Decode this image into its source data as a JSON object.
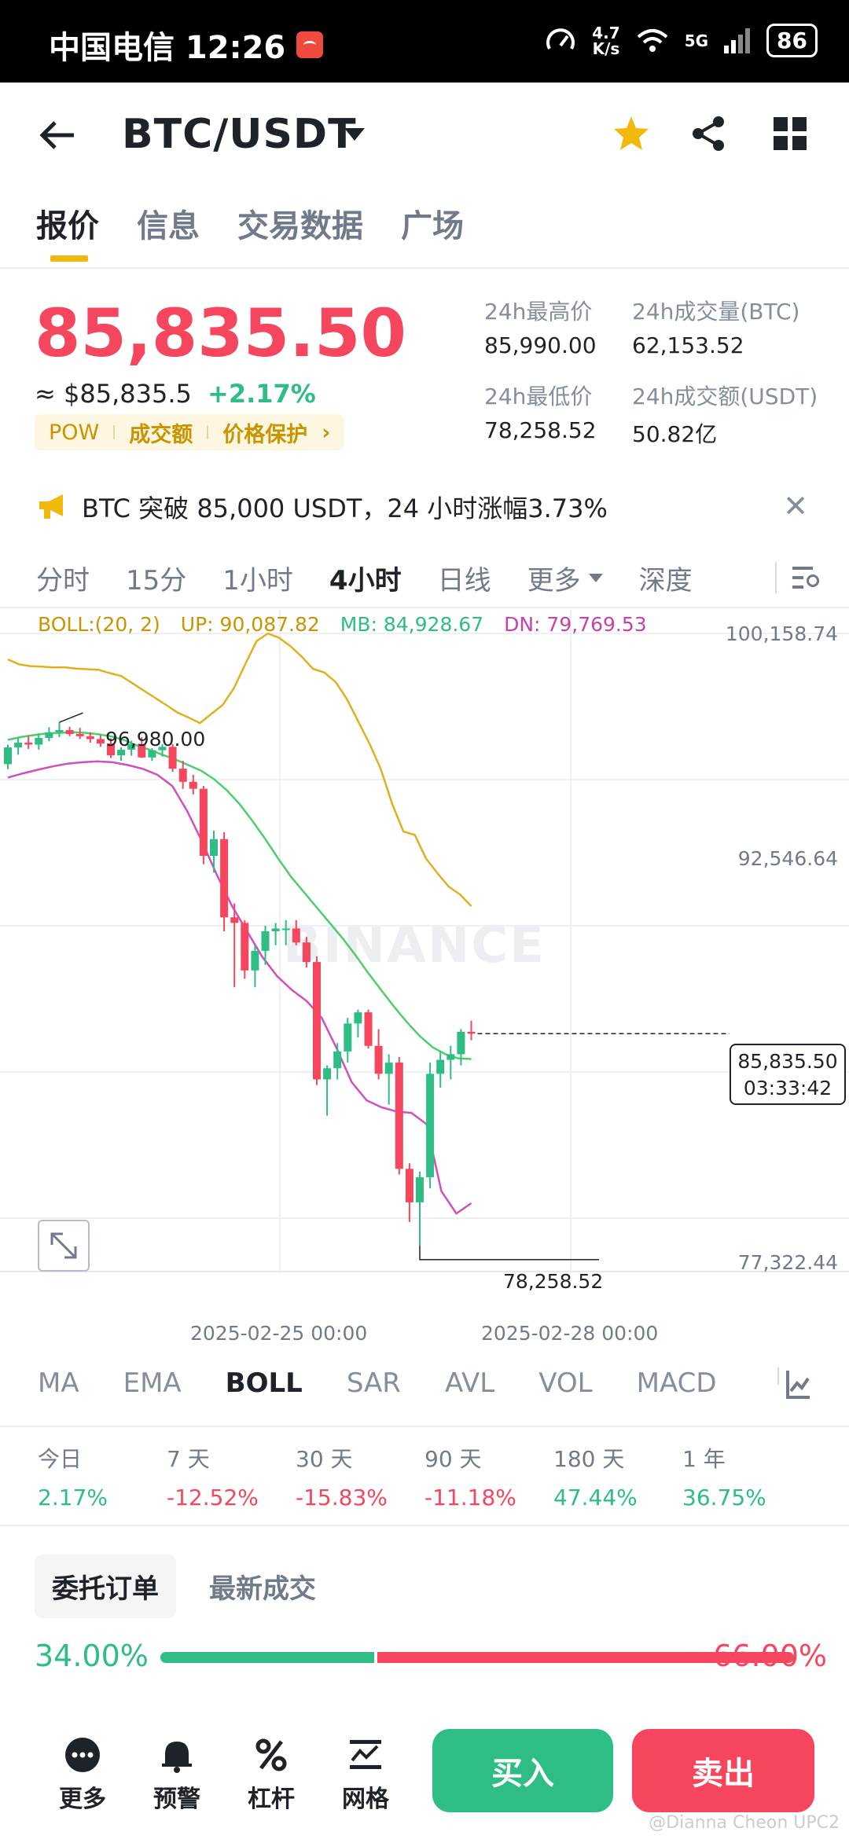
{
  "status_bar": {
    "carrier_time": "中国电信 12:26",
    "speed_value": "4.7",
    "speed_unit": "K/s",
    "network": "5G",
    "battery": "86"
  },
  "header": {
    "pair": "BTC/USDT"
  },
  "tabs": [
    {
      "label": "报价",
      "active": true
    },
    {
      "label": "信息",
      "active": false
    },
    {
      "label": "交易数据",
      "active": false
    },
    {
      "label": "广场",
      "active": false
    }
  ],
  "price": {
    "last": "85,835.50",
    "usd_equiv": "≈ $85,835.5",
    "change_pct": "+2.17%",
    "tags": [
      "POW",
      "成交额",
      "价格保护"
    ]
  },
  "stats": {
    "high_label": "24h最高价",
    "high": "85,990.00",
    "vol_btc_label": "24h成交量(BTC)",
    "vol_btc": "62,153.52",
    "low_label": "24h最低价",
    "low": "78,258.52",
    "vol_usdt_label": "24h成交额(USDT)",
    "vol_usdt": "50.82亿"
  },
  "announcement": "BTC 突破 85,000 USDT，24 小时涨幅3.73%",
  "intervals": {
    "items": [
      "分时",
      "15分",
      "1小时",
      "4小时",
      "日线"
    ],
    "active": "4小时",
    "more": "更多",
    "depth": "深度"
  },
  "chart": {
    "legend": {
      "boll": "BOLL:(20, 2)",
      "up": "UP: 90,087.82",
      "mb": "MB: 84,928.67",
      "dn": "DN: 79,769.53"
    },
    "y_labels": [
      "100,158.74",
      "92,546.64",
      "77,322.44"
    ],
    "x_labels": [
      "2025-02-25 00:00",
      "2025-02-28 00:00"
    ],
    "watermark": "BINANCE",
    "last_price": "85,835.50",
    "countdown": "03:33:42",
    "max_label": "96,980.00",
    "min_label": "78,258.52",
    "colors": {
      "up": "#2ebd85",
      "down": "#f6465d",
      "boll_up": "#e0b01f",
      "boll_mb": "#4ccf6a",
      "boll_dn": "#d04fbf"
    }
  },
  "chart_data": {
    "type": "candlestick",
    "title": "BTC/USDT 4小时",
    "ylim": [
      77322.44,
      100158.74
    ],
    "x_ticks": [
      "2025-02-25 00:00",
      "2025-02-28 00:00"
    ],
    "candles": [
      [
        95480,
        96180,
        95300,
        96080
      ],
      [
        96080,
        96420,
        95820,
        96250
      ],
      [
        96250,
        96500,
        96020,
        96180
      ],
      [
        96180,
        96580,
        96000,
        96420
      ],
      [
        96420,
        96800,
        96300,
        96620
      ],
      [
        96620,
        96980,
        96450,
        96700
      ],
      [
        96700,
        96820,
        96480,
        96560
      ],
      [
        96560,
        96780,
        96380,
        96480
      ],
      [
        96480,
        96620,
        96250,
        96380
      ],
      [
        96380,
        96520,
        96100,
        96220
      ],
      [
        96220,
        96400,
        95700,
        95800
      ],
      [
        95800,
        96080,
        95600,
        96000
      ],
      [
        96000,
        96320,
        95780,
        96200
      ],
      [
        96200,
        96450,
        95700,
        95720
      ],
      [
        95720,
        96050,
        95600,
        95980
      ],
      [
        95980,
        96200,
        95750,
        96100
      ],
      [
        96100,
        96200,
        95200,
        95320
      ],
      [
        95320,
        95600,
        94600,
        94850
      ],
      [
        94850,
        95100,
        94400,
        94600
      ],
      [
        94600,
        94700,
        91900,
        92200
      ],
      [
        92200,
        93100,
        91600,
        92800
      ],
      [
        92800,
        93050,
        89500,
        90000
      ],
      [
        90000,
        90500,
        87500,
        89800
      ],
      [
        89800,
        89900,
        87800,
        88100
      ],
      [
        88100,
        89000,
        87500,
        88800
      ],
      [
        88800,
        89700,
        88300,
        89500
      ],
      [
        89500,
        89800,
        89000,
        89600
      ],
      [
        89600,
        89900,
        89000,
        89600
      ],
      [
        89600,
        89900,
        89000,
        89100
      ],
      [
        89100,
        89300,
        88200,
        88400
      ],
      [
        88400,
        88600,
        84000,
        84200
      ],
      [
        84200,
        84700,
        82900,
        84600
      ],
      [
        84600,
        85500,
        84200,
        85200
      ],
      [
        85200,
        86400,
        84800,
        86200
      ],
      [
        86200,
        86700,
        85700,
        86600
      ],
      [
        86600,
        86700,
        85300,
        85400
      ],
      [
        85400,
        86000,
        84200,
        84400
      ],
      [
        84400,
        85100,
        83300,
        84800
      ],
      [
        84800,
        85000,
        80800,
        81000
      ],
      [
        81000,
        81200,
        79100,
        79800
      ],
      [
        79800,
        80900,
        78258.52,
        80700
      ],
      [
        80700,
        84800,
        80300,
        84400
      ],
      [
        84400,
        85200,
        83900,
        84900
      ],
      [
        84900,
        85400,
        84200,
        85100
      ],
      [
        85100,
        86000,
        84700,
        85900
      ],
      [
        85900,
        86300,
        85600,
        85835.5
      ]
    ],
    "boll_up": [
      99230,
      99050,
      98990,
      98970,
      98940,
      98950,
      98900,
      98880,
      98860,
      98740,
      98640,
      98380,
      98120,
      97860,
      97600,
      97330,
      97150,
      96950,
      97280,
      97600,
      98200,
      99050,
      99880,
      100158,
      100000,
      99700,
      99330,
      98890,
      98760,
      98420,
      97810,
      97010,
      96210,
      95300,
      94060,
      93070,
      92950,
      92100,
      91580,
      91100,
      90820,
      90400
    ],
    "boll_mb": [
      96350,
      96450,
      96520,
      96580,
      96600,
      96620,
      96600,
      96550,
      96480,
      96350,
      96150,
      96000,
      95820,
      95650,
      95450,
      95250,
      94950,
      94550,
      94050,
      93450,
      92800,
      92100,
      91450,
      90900,
      90350,
      89800,
      89250,
      88650,
      88000,
      87400,
      86800,
      86250,
      85750,
      85350,
      85100,
      84950,
      84928.67
    ],
    "boll_dn": [
      95000,
      95150,
      95280,
      95400,
      95500,
      95550,
      95580,
      95550,
      95450,
      95320,
      95100,
      94700,
      93800,
      92700,
      91500,
      90400,
      89500,
      88600,
      87900,
      87400,
      87000,
      86400,
      85300,
      84100,
      83450,
      83200,
      83050,
      83000,
      82600,
      80200,
      79400,
      79769.53
    ]
  },
  "indicators": {
    "items": [
      "MA",
      "EMA",
      "BOLL",
      "SAR",
      "AVL",
      "VOL",
      "MACD"
    ],
    "active": "BOLL"
  },
  "performance": [
    {
      "label": "今日",
      "value": "2.17%",
      "dir": "up"
    },
    {
      "label": "7 天",
      "value": "-12.52%",
      "dir": "down"
    },
    {
      "label": "30 天",
      "value": "-15.83%",
      "dir": "down"
    },
    {
      "label": "90 天",
      "value": "-11.18%",
      "dir": "down"
    },
    {
      "label": "180 天",
      "value": "47.44%",
      "dir": "up"
    },
    {
      "label": "1 年",
      "value": "36.75%",
      "dir": "up"
    }
  ],
  "order_tabs": {
    "orders": "委托订单",
    "trades": "最新成交"
  },
  "ratio": {
    "buy_text": "34.00%",
    "sell_text": "66.00%",
    "buy_fraction": 0.34
  },
  "bottom": {
    "more": "更多",
    "alert": "预警",
    "leverage": "杠杆",
    "grid": "网格",
    "buy": "买入",
    "sell": "卖出"
  },
  "credit": "@Dianna Cheon UPC2"
}
